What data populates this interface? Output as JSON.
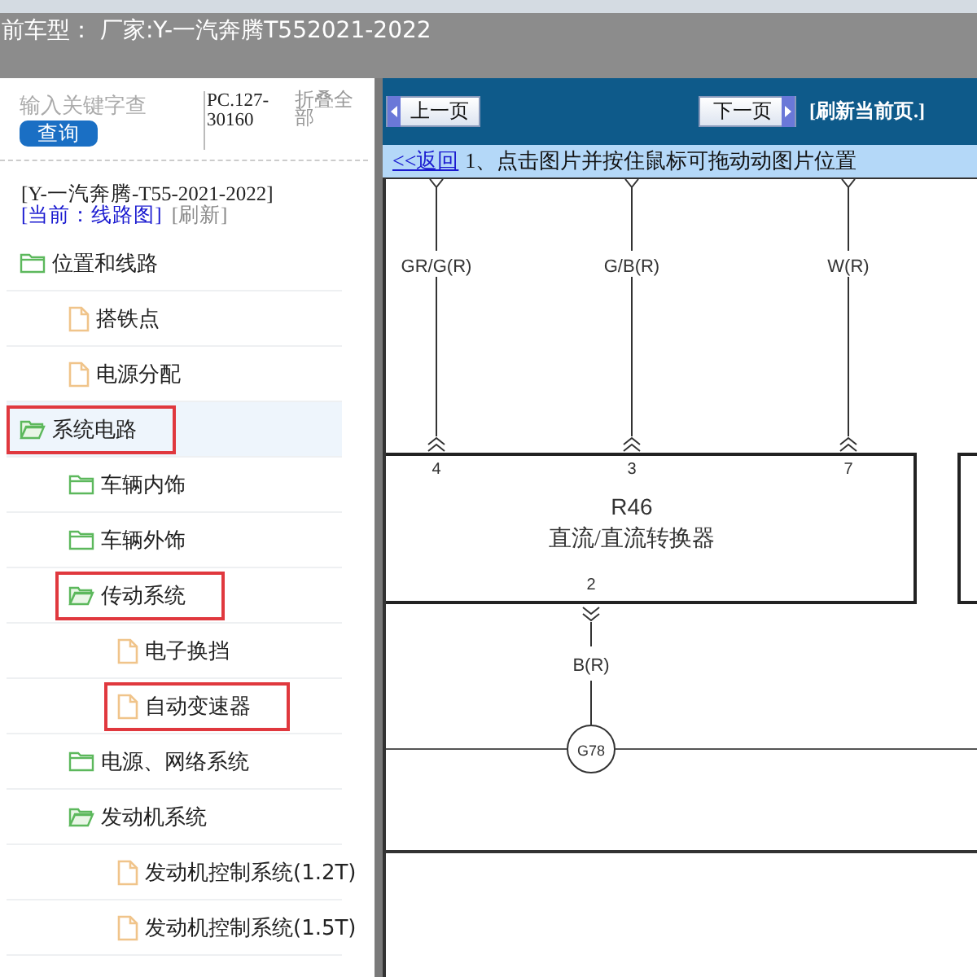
{
  "top_bar": {
    "title": "前车型：  厂家:Y-一汽奔腾T552021-2022"
  },
  "search": {
    "placeholder": "输入关键字查",
    "button": "查询",
    "code": "PC.127-30160",
    "collapse": "折叠全部"
  },
  "model": {
    "name": "[Y-一汽奔腾-T55-2021-2022]",
    "current": "[当前：线路图]",
    "refresh": "[刷新]"
  },
  "tree": [
    {
      "kind": "folder",
      "label": "位置和线路",
      "expanded": false,
      "selected": false,
      "highlighted": false,
      "children": [
        {
          "kind": "file",
          "label": "搭铁点",
          "selected": false,
          "highlighted": false
        },
        {
          "kind": "file",
          "label": "电源分配",
          "selected": false,
          "highlighted": false
        }
      ]
    },
    {
      "kind": "folder",
      "label": "系统电路",
      "expanded": true,
      "selected": true,
      "highlighted": true,
      "children": [
        {
          "kind": "folder",
          "label": "车辆内饰",
          "expanded": false,
          "selected": false,
          "highlighted": false
        },
        {
          "kind": "folder",
          "label": "车辆外饰",
          "expanded": false,
          "selected": false,
          "highlighted": false
        },
        {
          "kind": "folder",
          "label": "传动系统",
          "expanded": true,
          "selected": false,
          "highlighted": true,
          "children": [
            {
              "kind": "file",
              "label": "电子换挡",
              "selected": false,
              "highlighted": false
            },
            {
              "kind": "file",
              "label": "自动变速器",
              "selected": false,
              "highlighted": true
            }
          ]
        },
        {
          "kind": "folder",
          "label": "电源、网络系统",
          "expanded": false,
          "selected": false,
          "highlighted": false
        },
        {
          "kind": "folder",
          "label": "发动机系统",
          "expanded": true,
          "selected": false,
          "highlighted": false,
          "children": [
            {
              "kind": "file",
              "label": "发动机控制系统(1.2T)",
              "selected": false,
              "highlighted": false
            },
            {
              "kind": "file",
              "label": "发动机控制系统(1.5T)",
              "selected": false,
              "highlighted": false
            }
          ]
        }
      ]
    }
  ],
  "viewer": {
    "prev": "上一页",
    "next": "下一页",
    "refresh": "[刷新当前页.]",
    "back": "<<返回",
    "hint": "1、点击图片并按住鼠标可拖动动图片位置"
  },
  "diagram": {
    "wires": [
      {
        "label": "GR/G(R)",
        "pin": "4"
      },
      {
        "label": "G/B(R)",
        "pin": "3"
      },
      {
        "label": "W(R)",
        "pin": "7"
      }
    ],
    "component": {
      "id": "R46",
      "name": "直流/直流转换器",
      "bottom_pin": "2"
    },
    "ground_wire": {
      "label": "B(R)"
    },
    "splice": "G78"
  }
}
